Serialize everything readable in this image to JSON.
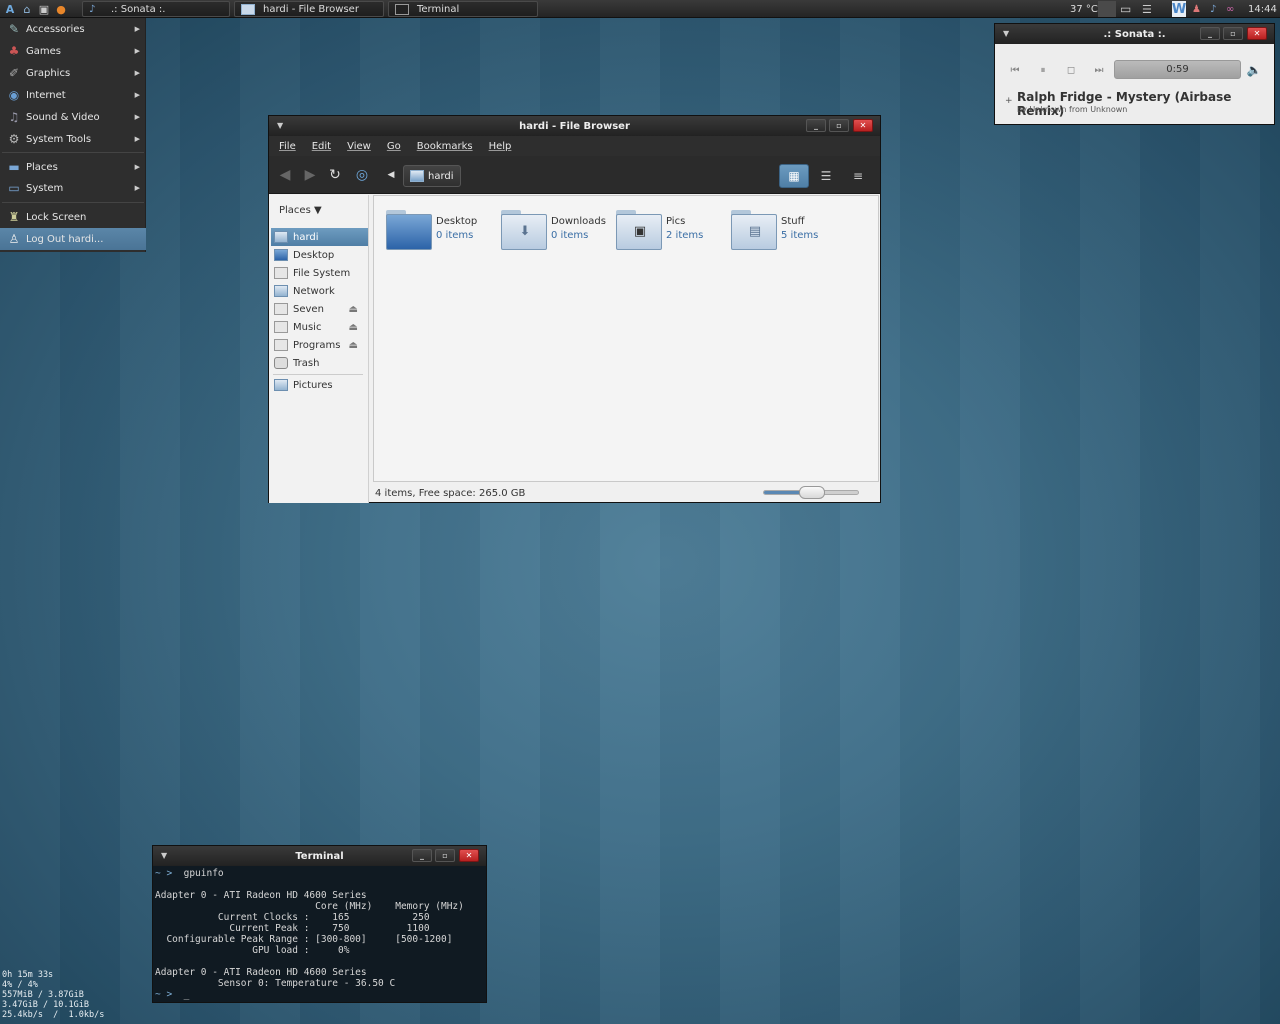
{
  "panel": {
    "tasks": [
      {
        "label": ".: Sonata :."
      },
      {
        "label": "hardi - File Browser"
      },
      {
        "label": "Terminal"
      }
    ],
    "temperature": "37 °C",
    "clock": "14:44"
  },
  "app_menu": {
    "items": [
      {
        "label": "Accessories",
        "icon": "accessories-icon"
      },
      {
        "label": "Games",
        "icon": "games-icon"
      },
      {
        "label": "Graphics",
        "icon": "graphics-icon"
      },
      {
        "label": "Internet",
        "icon": "internet-icon"
      },
      {
        "label": "Sound & Video",
        "icon": "sound-video-icon"
      },
      {
        "label": "System Tools",
        "icon": "system-tools-icon"
      },
      {
        "label": "Places",
        "icon": "places-icon"
      },
      {
        "label": "System",
        "icon": "system-icon"
      },
      {
        "label": "Lock Screen",
        "icon": "lock-screen-icon"
      },
      {
        "label": "Log Out hardi...",
        "icon": "logout-icon"
      }
    ]
  },
  "file_browser": {
    "title": "hardi - File Browser",
    "menus": [
      "File",
      "Edit",
      "View",
      "Go",
      "Bookmarks",
      "Help"
    ],
    "path": "hardi",
    "sidebar_header": "Places",
    "places": [
      {
        "label": "hardi"
      },
      {
        "label": "Desktop"
      },
      {
        "label": "File System"
      },
      {
        "label": "Network"
      },
      {
        "label": "Seven"
      },
      {
        "label": "Music"
      },
      {
        "label": "Programs"
      },
      {
        "label": "Trash"
      },
      {
        "label": "Pictures"
      }
    ],
    "files": [
      {
        "name": "Desktop",
        "count": "0 items"
      },
      {
        "name": "Downloads",
        "count": "0 items"
      },
      {
        "name": "Pics",
        "count": "2 items"
      },
      {
        "name": "Stuff",
        "count": "5 items"
      }
    ],
    "status": "4 items, Free space: 265.0 GB",
    "zoom_level": 0.5
  },
  "sonata": {
    "title": ".: Sonata :.",
    "time": "0:59",
    "song": "Ralph Fridge - Mystery (Airbase Remix)",
    "byline": "by Unknown from Unknown"
  },
  "terminal": {
    "title": "Terminal",
    "lines": [
      "~ >  gpuinfo",
      "",
      "Adapter 0 - ATI Radeon HD 4600 Series",
      "                            Core (MHz)    Memory (MHz)",
      "           Current Clocks :    165           250",
      "             Current Peak :    750          1100",
      "  Configurable Peak Range : [300-800]     [500-1200]",
      "                 GPU load :     0%",
      "",
      "Adapter 0 - ATI Radeon HD 4600 Series",
      "           Sensor 0: Temperature - 36.50 C",
      "~ >  _"
    ]
  },
  "conky": {
    "lines": [
      "0h 15m 33s",
      "4% / 4%",
      "557MiB / 3.87GiB",
      "3.47GiB / 10.1GiB",
      "25.4kb/s  /  1.0kb/s"
    ]
  }
}
